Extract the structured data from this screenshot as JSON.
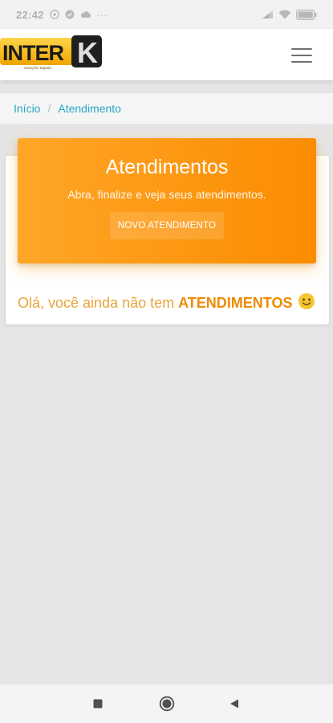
{
  "status_bar": {
    "time": "22:42",
    "dots": "···",
    "battery": "100"
  },
  "navbar": {
    "logo_text": "INTERK",
    "logo_sub": "Soluções Digitais"
  },
  "breadcrumb": {
    "home": "Início",
    "separator": "/",
    "current": "Atendimento"
  },
  "card": {
    "title": "Atendimentos",
    "subtitle": "Abra, finalize e veja seus atendimentos.",
    "new_button": "NOVO ATENDIMENTO",
    "empty_prefix": "Olá, você ainda não tem ",
    "empty_highlight": "ATENDIMENTOS"
  },
  "colors": {
    "accent_orange": "#fb8c00",
    "link": "#26a8c8",
    "message": "#e8a33a"
  },
  "icons": {
    "menu": "hamburger-icon",
    "smiley": "smiley-icon",
    "recent": "square-icon",
    "home": "circle-icon",
    "back": "triangle-back-icon"
  }
}
